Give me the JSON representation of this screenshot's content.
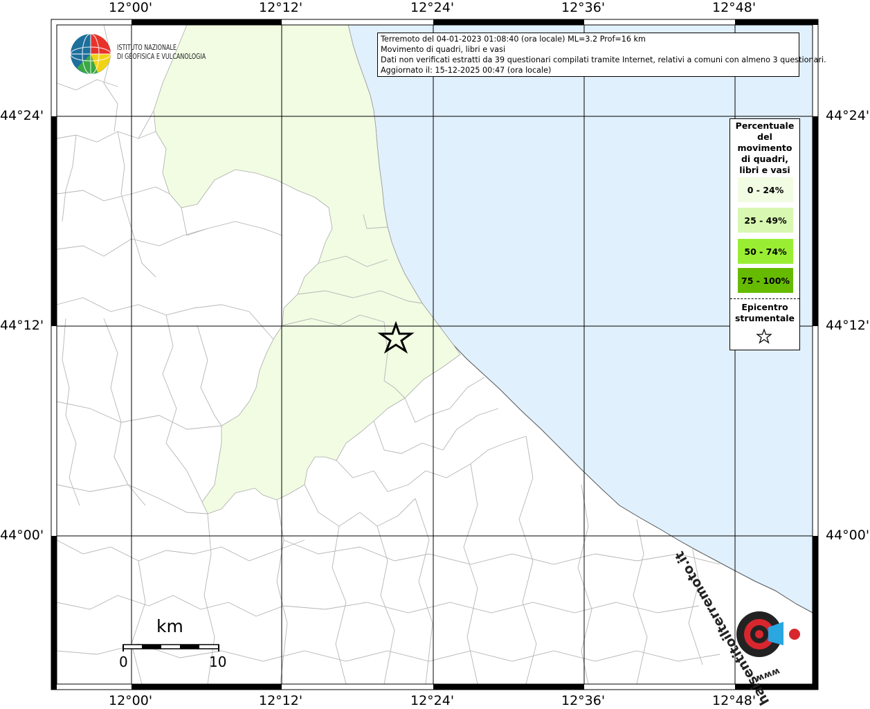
{
  "map": {
    "lon_labels": [
      "12°00'",
      "12°12'",
      "12°24'",
      "12°36'",
      "12°48'"
    ],
    "lat_labels": [
      "44°24'",
      "44°12'",
      "44°00'"
    ]
  },
  "info": {
    "line1": "Terremoto del 04-01-2023 01:08:40 (ora locale) ML=3.2 Prof=16 km",
    "line2": "Movimento di quadri, libri e vasi",
    "line3": "Dati non verificati estratti da 39 questionari compilati tramite Internet, relativi a comuni con almeno 3 questionari.",
    "line4": "Aggiornato il: 15-12-2025 00:47 (ora locale)"
  },
  "legend": {
    "title_lines": [
      "Percentuale",
      "del",
      "movimento",
      "di quadri,",
      "libri e vasi"
    ],
    "classes": [
      {
        "label": "0 - 24%",
        "color": "#f1fce3"
      },
      {
        "label": "25 - 49%",
        "color": "#d8f7b0"
      },
      {
        "label": "50 - 74%",
        "color": "#99ee33"
      },
      {
        "label": "75 - 100%",
        "color": "#66bb00"
      }
    ],
    "epicenter_lines": [
      "Epicentro",
      "strumentale"
    ]
  },
  "logo": {
    "ingv_line1": "ISTITUTO NAZIONALE",
    "ingv_line2": "DI GEOFISICA E VULCANOLOGIA",
    "hst_text": "haisentitoilterremoto.it",
    "hst_url": "www."
  },
  "scale_bar": {
    "unit": "km",
    "start": "0",
    "end": "10"
  },
  "colors": {
    "sea": "#e0f0fc",
    "land": "#ffffff",
    "affected": "#f1fce3",
    "grid": "#000000",
    "boundaries": "#b5b5b5"
  }
}
